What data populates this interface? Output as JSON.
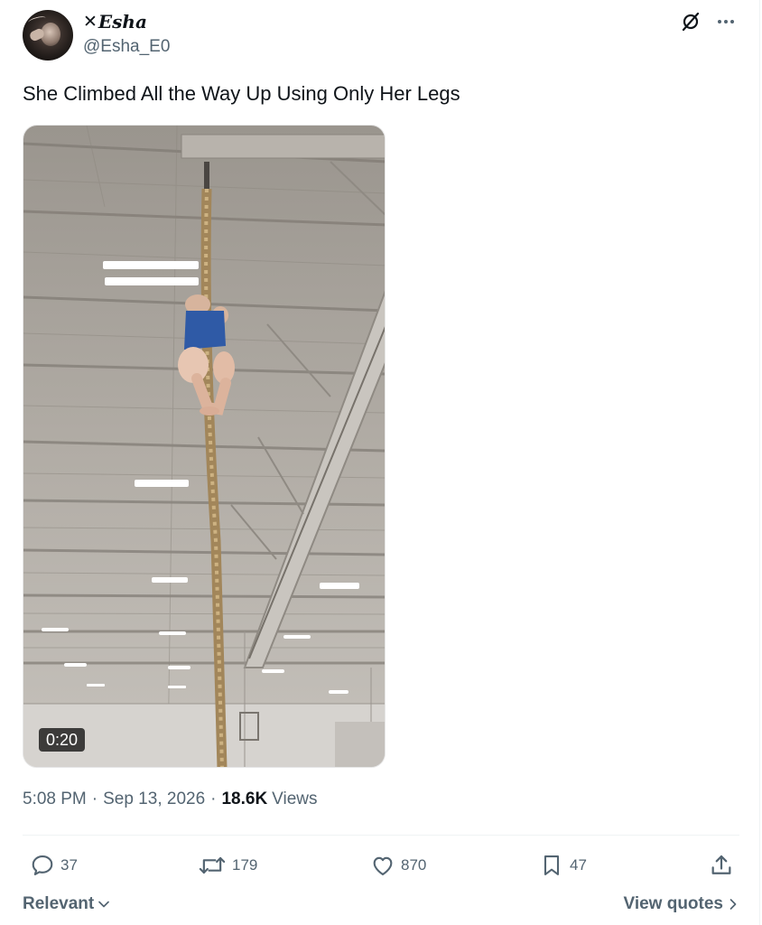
{
  "author": {
    "name_prefix": "✕",
    "name": "Esha",
    "handle": "@Esha_E0"
  },
  "tweet": {
    "text": "She Climbed All the Way Up Using Only Her Legs",
    "video_duration": "0:20"
  },
  "meta": {
    "time": "5:08 PM",
    "dot1": "·",
    "date": "Sep 13, 2026",
    "dot2": "·",
    "views_count": "18.6K",
    "views_label": "Views"
  },
  "actions": {
    "replies": "37",
    "reposts": "179",
    "likes": "870",
    "bookmarks": "47"
  },
  "footer": {
    "sort_label": "Relevant",
    "quotes_label": "View quotes"
  },
  "icons": [
    "grok-icon",
    "more-icon",
    "reply-icon",
    "repost-icon",
    "like-icon",
    "bookmark-icon",
    "share-icon",
    "chevron-down-icon",
    "chevron-right-icon"
  ],
  "colors": {
    "text": "#0f1419",
    "secondary": "#536471",
    "divider": "#eff3f4"
  }
}
